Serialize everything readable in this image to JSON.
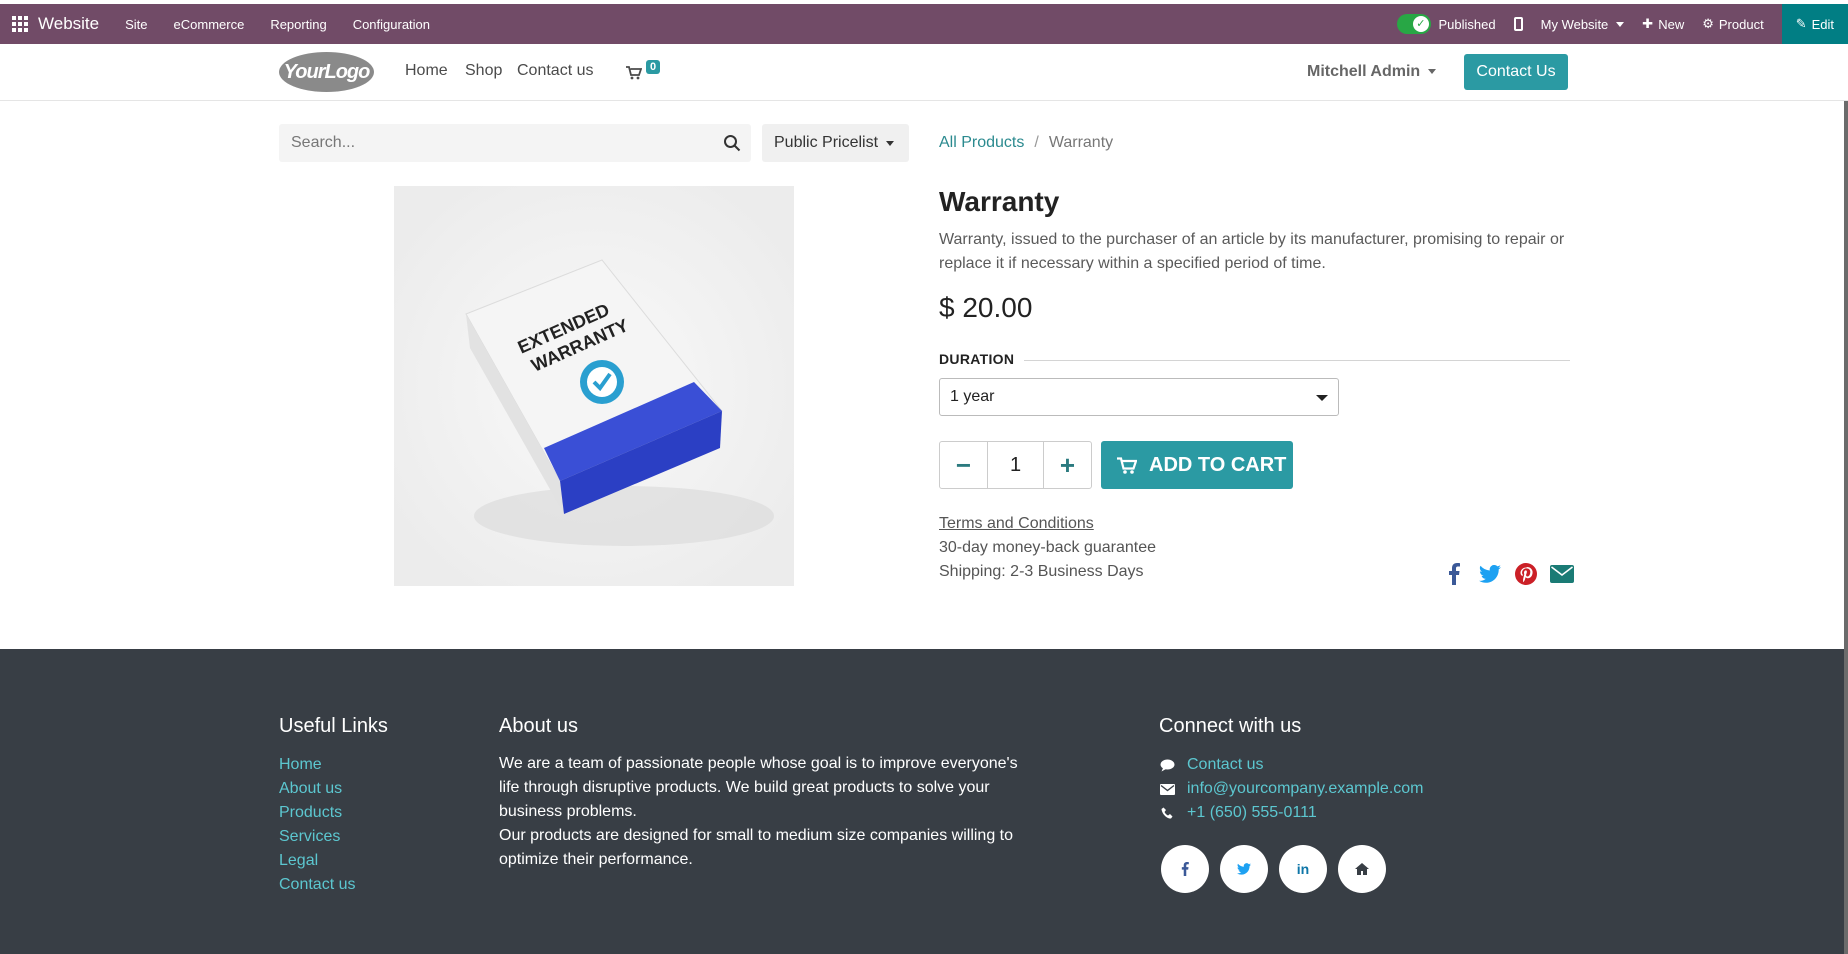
{
  "topbar": {
    "brand": "Website",
    "menus": [
      "Site",
      "eCommerce",
      "Reporting",
      "Configuration"
    ],
    "published": "Published",
    "my_website": "My Website",
    "new": "New",
    "product": "Product",
    "edit": "Edit",
    "color": "#714b67",
    "edit_color": "#017e84"
  },
  "header": {
    "logo": "YourLogo",
    "nav": [
      "Home",
      "Shop",
      "Contact us"
    ],
    "cart_count": "0",
    "user": "Mitchell Admin",
    "contact_button": "Contact Us",
    "accent": "#2b9aa3"
  },
  "search": {
    "placeholder": "Search...",
    "pricelist": "Public Pricelist"
  },
  "breadcrumb": {
    "parent": "All Products",
    "current": "Warranty"
  },
  "product": {
    "image_label": [
      "EXTENDED",
      "WARRANTY"
    ],
    "name": "Warranty",
    "description": "Warranty, issued to the purchaser of an article by its manufacturer, promising to repair or replace it if necessary within a specified period of time.",
    "price": "$ 20.00",
    "attribute_label": "DURATION",
    "attribute_value": "1 year",
    "quantity": "1",
    "add_to_cart": "ADD TO CART",
    "terms": "Terms and Conditions",
    "guarantee": "30-day money-back guarantee",
    "shipping": "Shipping: 2-3 Business Days"
  },
  "footer": {
    "useful_links_title": "Useful Links",
    "useful_links": [
      "Home",
      "About us",
      "Products",
      "Services",
      "Legal",
      "Contact us"
    ],
    "about_title": "About us",
    "about_p1": "We are a team of passionate people whose goal is to improve everyone's life through disruptive products. We build great products to solve your business problems.",
    "about_p2": "Our products are designed for small to medium size companies willing to optimize their performance.",
    "connect_title": "Connect with us",
    "connect": [
      "Contact us",
      "info@yourcompany.example.com",
      "+1 (650) 555-0111"
    ],
    "background": "#383e45",
    "link_color": "#5cc7d0"
  }
}
